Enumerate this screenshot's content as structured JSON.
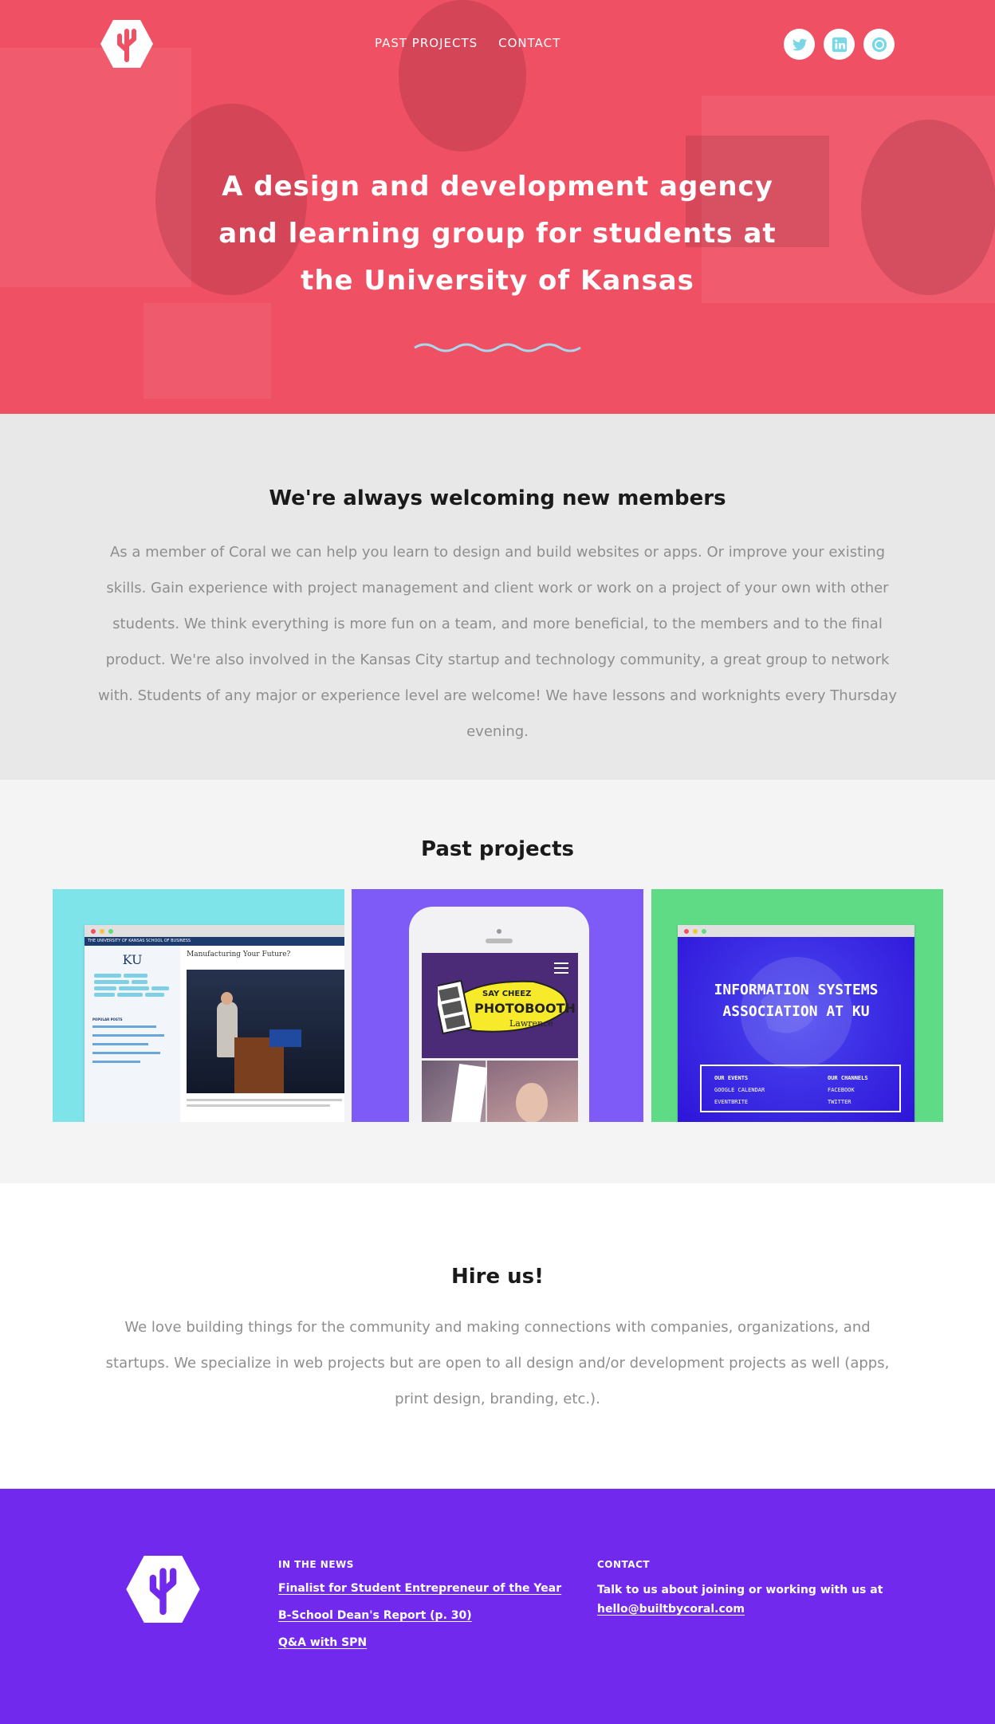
{
  "nav": {
    "items": [
      {
        "label": "PAST PROJECTS"
      },
      {
        "label": "CONTACT"
      }
    ]
  },
  "social": {
    "items": [
      {
        "icon": "twitter-icon",
        "color": "#7ad7e6"
      },
      {
        "icon": "linkedin-icon",
        "color": "#7ad7e6"
      },
      {
        "icon": "github-icon",
        "color": "#7ad7e6"
      }
    ]
  },
  "hero": {
    "lines": [
      "A design and development agency",
      "and learning group for students at",
      "the University of Kansas"
    ],
    "bg_color": "#ef5063"
  },
  "members": {
    "title": "We're always welcoming new members",
    "body": "As a member of Coral we can help you learn to design and build websites or apps. Or improve your existing skills. Gain experience with project management and client work or work on a project of your own with other students. We think everything is more fun on a team, and more beneficial, to the members and to the final product. We're also involved in the Kansas City startup and technology community, a great group to network with. Students of any major or experience level are welcome! We have lessons and worknights every Thursday evening."
  },
  "projects": {
    "title": "Past projects",
    "cards": [
      {
        "name": "ku-business-blog",
        "bg": "#7fe3ea",
        "header": "THE UNIVERSITY OF KANSAS SCHOOL OF BUSINESS",
        "logo": "KU",
        "post_title": "Manufacturing Your Future?",
        "sidebar_heading": "POPULAR POSTS"
      },
      {
        "name": "say-cheez-photobooth",
        "bg": "#7e5bf7",
        "line1": "SAY CHEEZ",
        "line2": "PHOTOBOOTH",
        "line3": "Lawrence"
      },
      {
        "name": "information-systems-association",
        "bg": "#5fdb85",
        "title_line1": "INFORMATION SYSTEMS",
        "title_line2": "ASSOCIATION AT KU",
        "events_head": "OUR EVENTS",
        "events": [
          "GOOGLE CALENDAR",
          "EVENTBRITE"
        ],
        "channels_head": "OUR CHANNELS",
        "channels": [
          "FACEBOOK",
          "TWITTER"
        ]
      }
    ]
  },
  "hire": {
    "title": "Hire us!",
    "body": "We love building things for the community and making connections with companies, organizations, and startups. We specialize in web projects but are open to all design and/or development projects as well (apps, print design, branding, etc.)."
  },
  "footer": {
    "news_head": "IN THE NEWS",
    "news": [
      {
        "label": "Finalist for Student Entrepreneur of the Year"
      },
      {
        "label": "B-School Dean's Report (p. 30)"
      },
      {
        "label": "Q&A with SPN"
      }
    ],
    "contact_head": "CONTACT",
    "contact_text": "Talk to us about joining or working with us at",
    "contact_email": "hello@builtbycoral.com",
    "bg_color": "#7229ee"
  }
}
